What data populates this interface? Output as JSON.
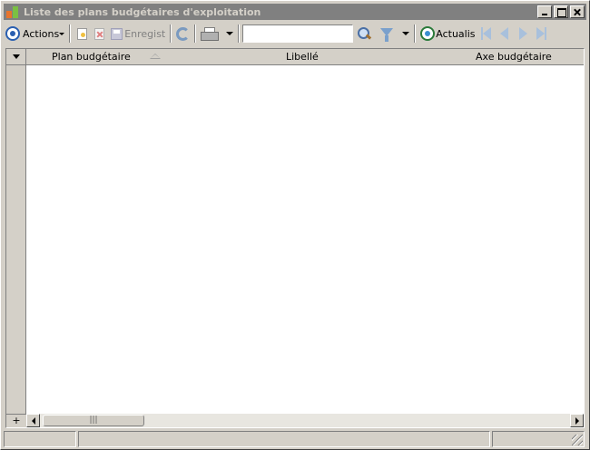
{
  "window": {
    "title": "Liste des plans budgétaires d'exploitation"
  },
  "toolbar": {
    "actions_label": "Actions",
    "save_label": "Enregist",
    "search_value": "",
    "refresh_label": "Actualis"
  },
  "grid": {
    "columns": [
      "Plan budgétaire",
      "Libellé",
      "Axe budgétaire"
    ],
    "sort_column": "Plan budgétaire",
    "sort_direction": "ascending",
    "rows": []
  },
  "scrollbar": {
    "add_label": "+",
    "thumb_label": "|||"
  },
  "status": {
    "cells": [
      "",
      "",
      ""
    ]
  }
}
